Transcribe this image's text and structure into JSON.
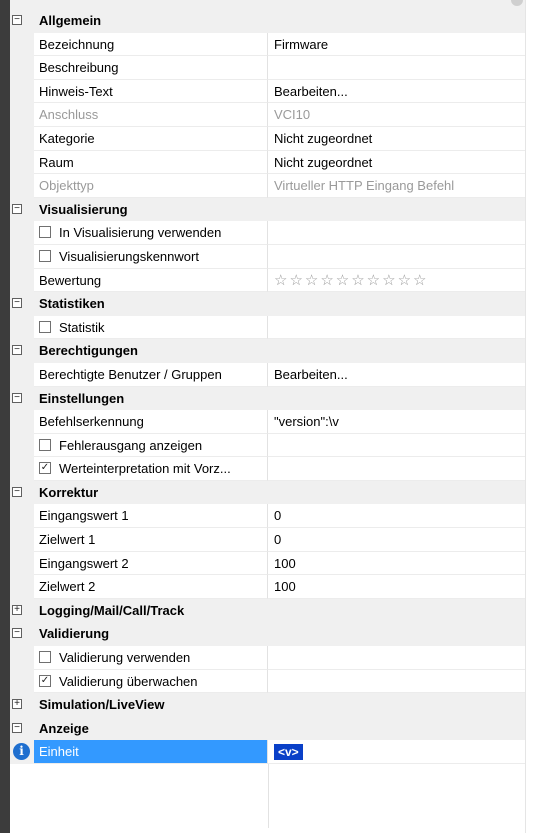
{
  "window": {
    "accent": "#3399ff",
    "token_color": "#0a40c8"
  },
  "sections": {
    "allgemein": {
      "label": "Allgemein",
      "bezeichnung": {
        "name": "Bezeichnung",
        "value": "Firmware"
      },
      "beschreibung": {
        "name": "Beschreibung",
        "value": ""
      },
      "hinweis": {
        "name": "Hinweis-Text",
        "value": "Bearbeiten..."
      },
      "anschluss": {
        "name": "Anschluss",
        "value": "VCI10"
      },
      "kategorie": {
        "name": "Kategorie",
        "value": "Nicht zugeordnet"
      },
      "raum": {
        "name": "Raum",
        "value": "Nicht zugeordnet"
      },
      "objekttyp": {
        "name": "Objekttyp",
        "value": "Virtueller HTTP Eingang Befehl"
      }
    },
    "visualisierung": {
      "label": "Visualisierung",
      "verwenden": {
        "name": "In Visualisierung verwenden",
        "checked": false
      },
      "kennwort": {
        "name": "Visualisierungskennwort",
        "checked": false
      },
      "bewertung": {
        "name": "Bewertung",
        "stars": "☆☆☆☆☆☆☆☆☆☆",
        "rating": 0,
        "max": 10
      }
    },
    "statistiken": {
      "label": "Statistiken",
      "statistik": {
        "name": "Statistik",
        "checked": false
      }
    },
    "berechtigungen": {
      "label": "Berechtigungen",
      "benutzer": {
        "name": "Berechtigte Benutzer / Gruppen",
        "value": "Bearbeiten..."
      }
    },
    "einstellungen": {
      "label": "Einstellungen",
      "befehl": {
        "name": "Befehlserkennung",
        "value": "\"version\":\\v"
      },
      "fehlerausgang": {
        "name": "Fehlerausgang anzeigen",
        "checked": false
      },
      "werteinterpretation": {
        "name": "Werteinterpretation mit Vorz...",
        "checked": true
      }
    },
    "korrektur": {
      "label": "Korrektur",
      "eingang1": {
        "name": "Eingangswert 1",
        "value": "0"
      },
      "ziel1": {
        "name": "Zielwert 1",
        "value": "0"
      },
      "eingang2": {
        "name": "Eingangswert 2",
        "value": "100"
      },
      "ziel2": {
        "name": "Zielwert 2",
        "value": "100"
      }
    },
    "logging": {
      "label": "Logging/Mail/Call/Track"
    },
    "validierung": {
      "label": "Validierung",
      "verwenden": {
        "name": "Validierung verwenden",
        "checked": false
      },
      "ueberwachen": {
        "name": "Validierung überwachen",
        "checked": true
      }
    },
    "simulation": {
      "label": "Simulation/LiveView"
    },
    "anzeige": {
      "label": "Anzeige",
      "einheit": {
        "name": "Einheit",
        "value": "<v>"
      }
    }
  },
  "glyphs": {
    "expanded": "⊟",
    "collapsed": "⊞",
    "check": "✓",
    "info": "i"
  }
}
